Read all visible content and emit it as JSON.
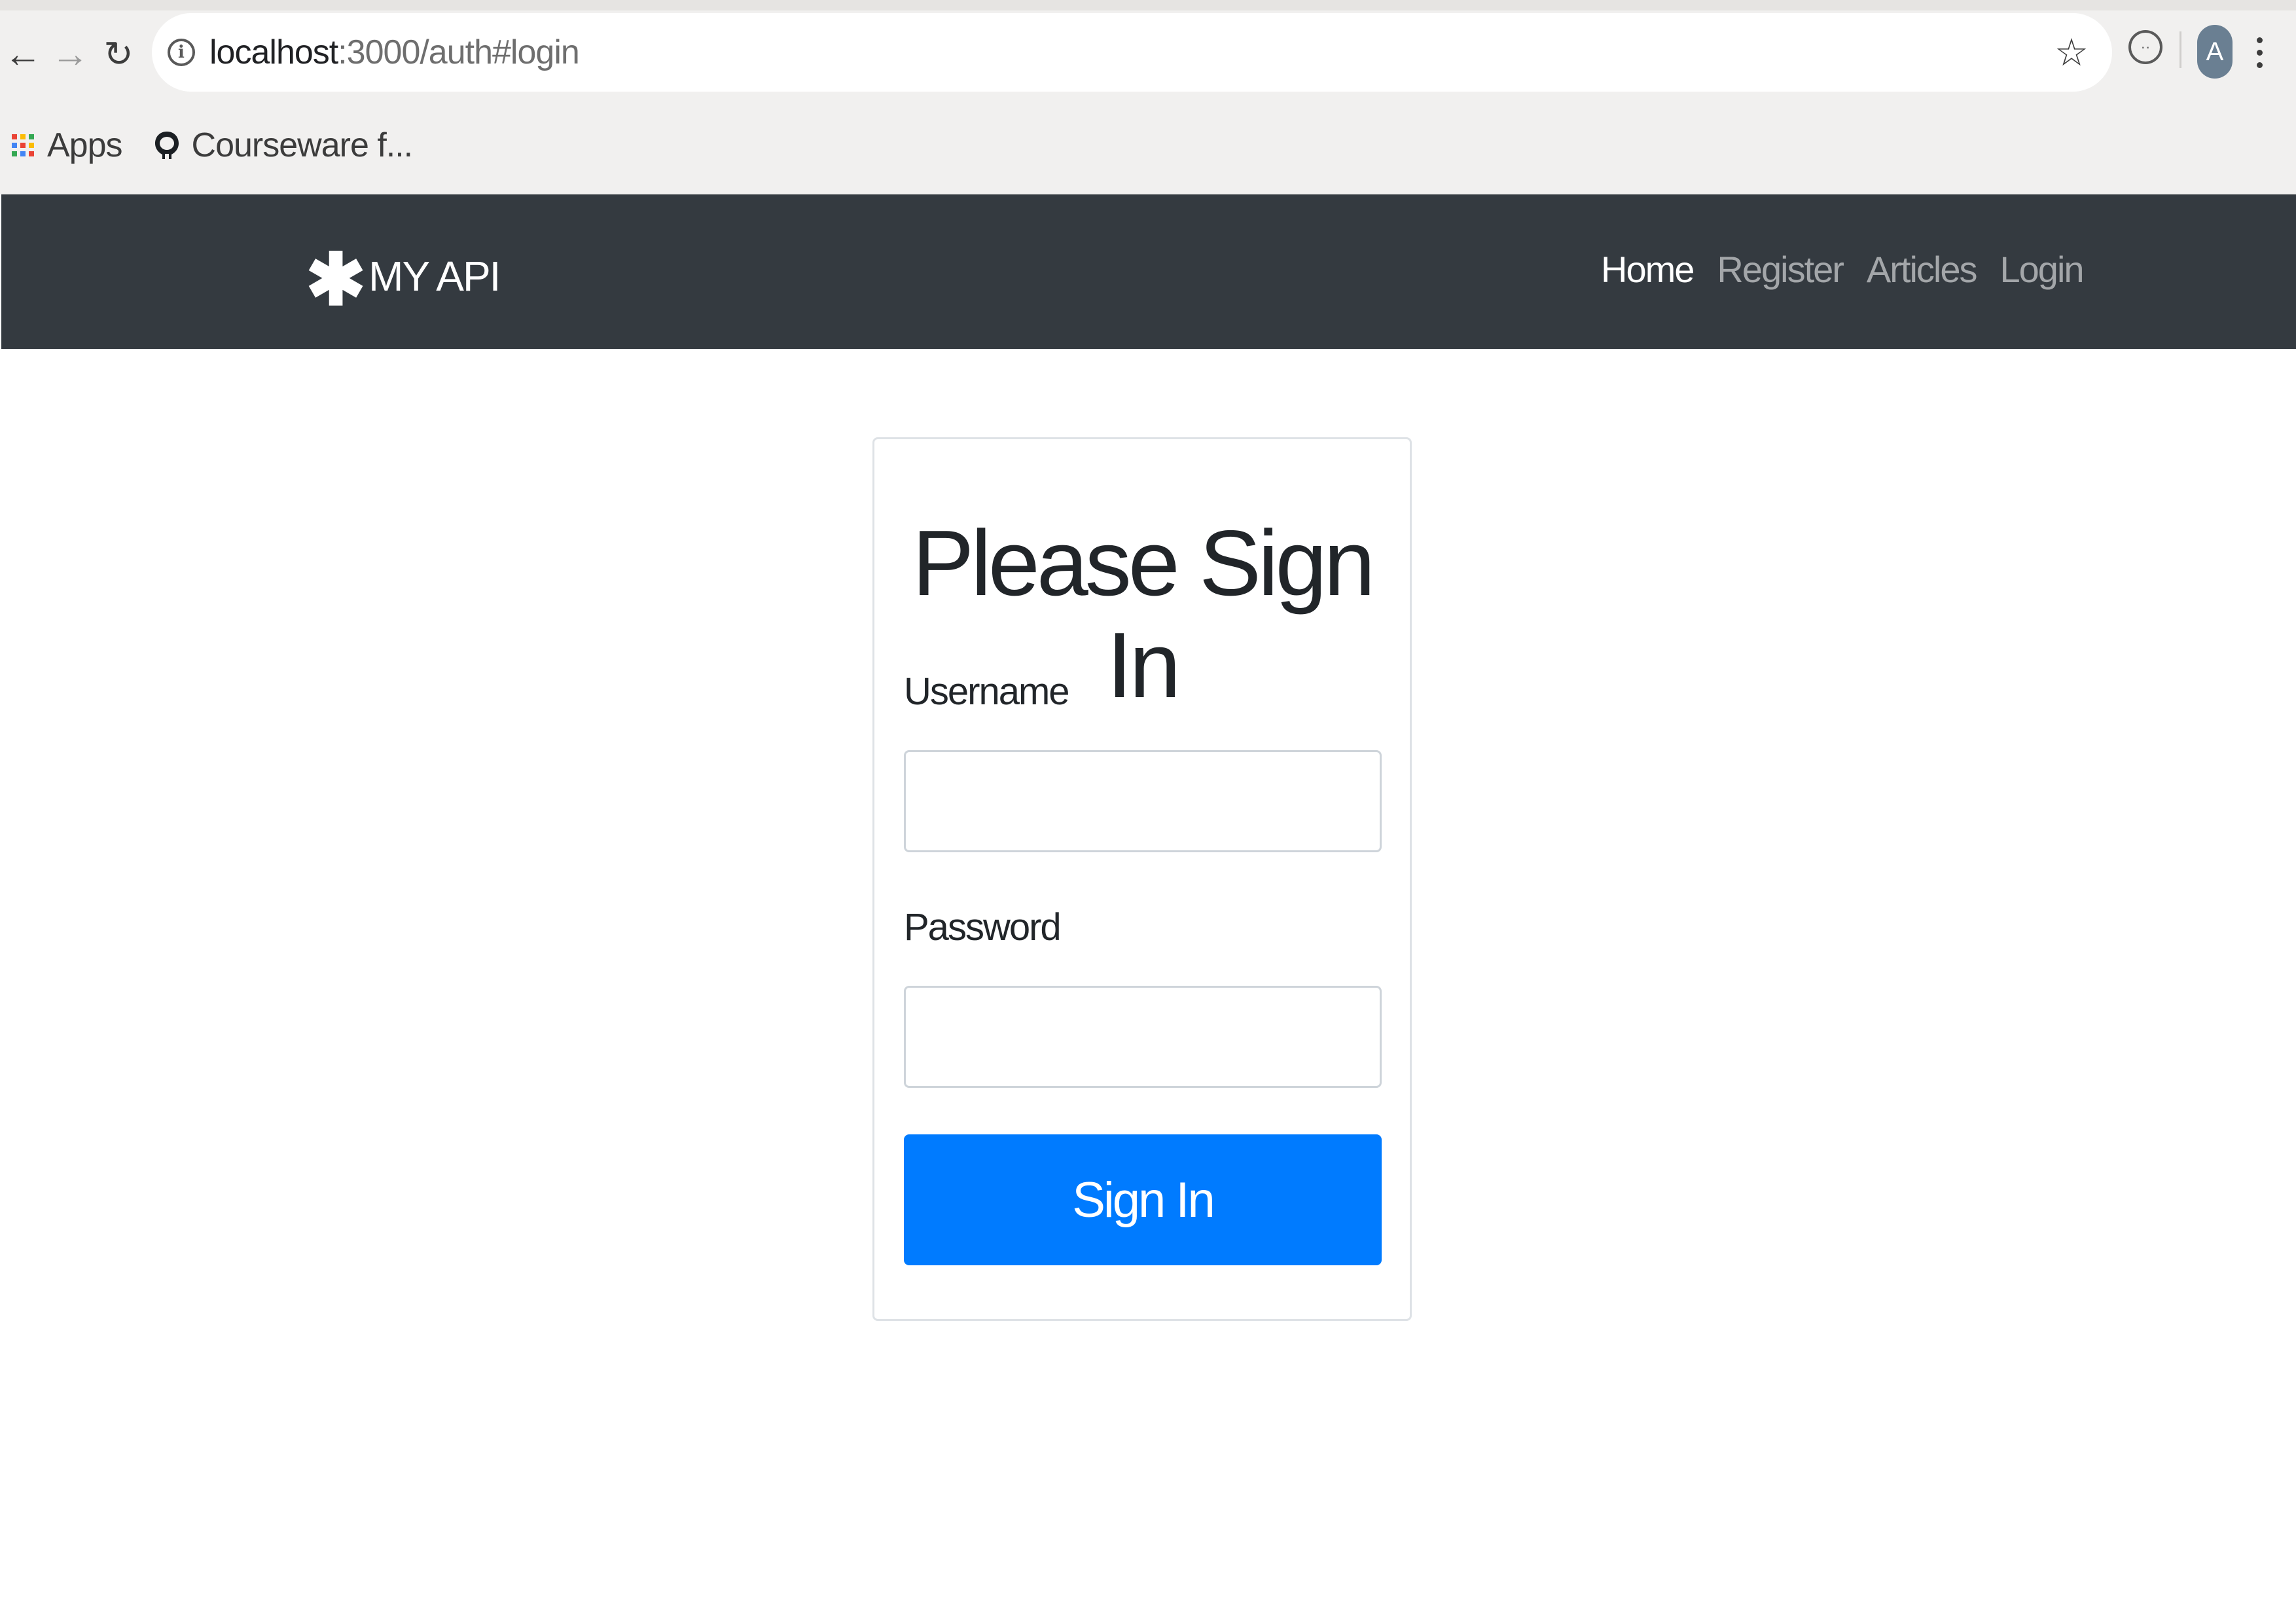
{
  "browser": {
    "url_host": "localhost",
    "url_path": ":3000/auth#login",
    "avatar_letter": "A",
    "bookmarks": [
      {
        "label": "Apps"
      },
      {
        "label": "Courseware f..."
      }
    ]
  },
  "navbar": {
    "brand": "MY API",
    "links": [
      "Home",
      "Register",
      "Articles",
      "Login"
    ],
    "active_link": "Home"
  },
  "login_form": {
    "title": "Please Sign In",
    "username_label": "Username",
    "username_value": "",
    "password_label": "Password",
    "password_value": "",
    "submit_label": "Sign In"
  },
  "colors": {
    "navbar_bg": "#343a40",
    "primary": "#007bff",
    "chrome_bg": "#f1f0ef"
  }
}
